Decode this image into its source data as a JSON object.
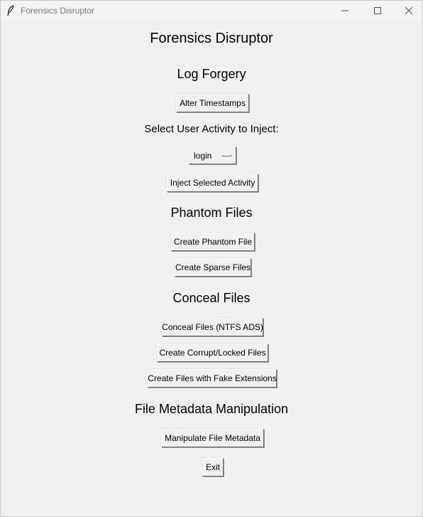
{
  "window": {
    "title": "Forensics Disruptor",
    "app_icon": "feather-icon",
    "controls": [
      "minimize-icon",
      "maximize-icon",
      "close-icon"
    ]
  },
  "main": {
    "title": "Forensics Disruptor"
  },
  "log_forgery": {
    "heading": "Log Forgery",
    "alter_timestamps_label": "Alter Timestamps",
    "select_activity_label": "Select User Activity to Inject:",
    "activity_selected": "login",
    "inject_activity_label": "Inject Selected Activity"
  },
  "phantom_files": {
    "heading": "Phantom Files",
    "create_phantom_label": "Create Phantom File",
    "create_sparse_label": "Create Sparse Files"
  },
  "conceal_files": {
    "heading": "Conceal Files",
    "conceal_ads_label": "Conceal Files (NTFS ADS)",
    "corrupt_locked_label": "Create Corrupt/Locked Files",
    "fake_extensions_label": "Create Files with Fake Extensions"
  },
  "metadata": {
    "heading": "File Metadata Manipulation",
    "manipulate_label": "Manipulate File Metadata"
  },
  "exit_label": "Exit"
}
